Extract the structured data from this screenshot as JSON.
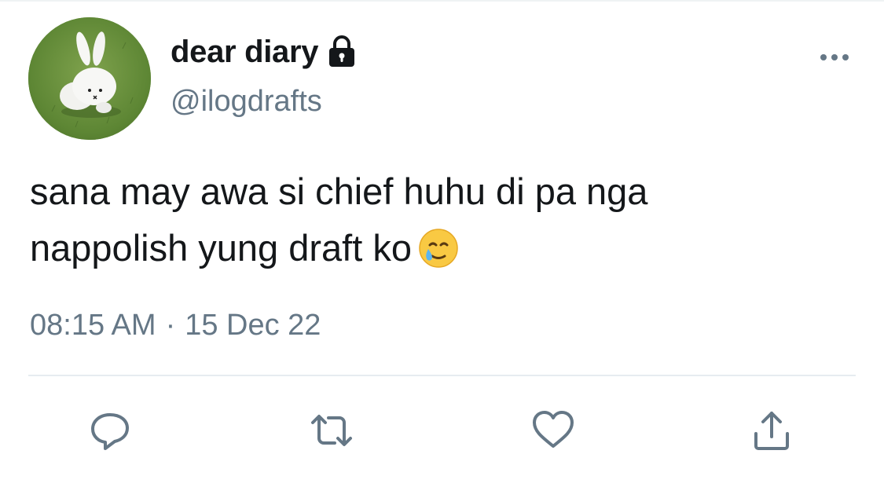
{
  "user": {
    "display_name": "dear diary",
    "handle": "@ilogdrafts",
    "avatar_icon": "bunny-avatar",
    "protected_icon": "lock-icon"
  },
  "tweet": {
    "text": "sana may awa si chief huhu di pa nga\nnappolish yung draft ko",
    "emoji": "smiling-face-with-tear-emoji",
    "time": "08:15 AM",
    "separator": "·",
    "date": "15 Dec 22"
  },
  "actions": [
    {
      "icon": "reply-icon"
    },
    {
      "icon": "retweet-icon"
    },
    {
      "icon": "like-icon"
    },
    {
      "icon": "share-icon"
    }
  ],
  "colors": {
    "text_primary": "#14171a",
    "text_secondary": "#657786",
    "icon": "#657786",
    "divider": "#e6ecf0"
  }
}
